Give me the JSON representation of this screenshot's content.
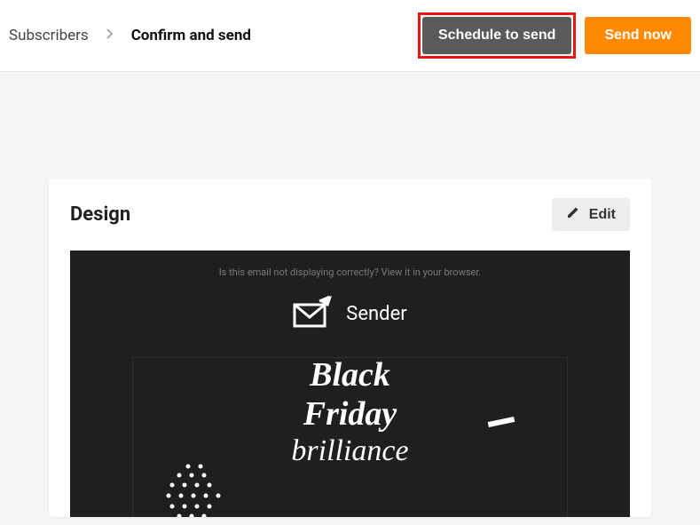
{
  "breadcrumb": {
    "previous": "Subscribers",
    "current": "Confirm and send"
  },
  "header": {
    "schedule_label": "Schedule to send",
    "send_label": "Send now"
  },
  "card": {
    "title": "Design",
    "edit_label": "Edit"
  },
  "preview": {
    "top_text": "Is this email not displaying correctly? View it in your browser.",
    "brand": "Sender",
    "hero_line1": "Black",
    "hero_line2": "Friday",
    "hero_line3": "brilliance"
  }
}
